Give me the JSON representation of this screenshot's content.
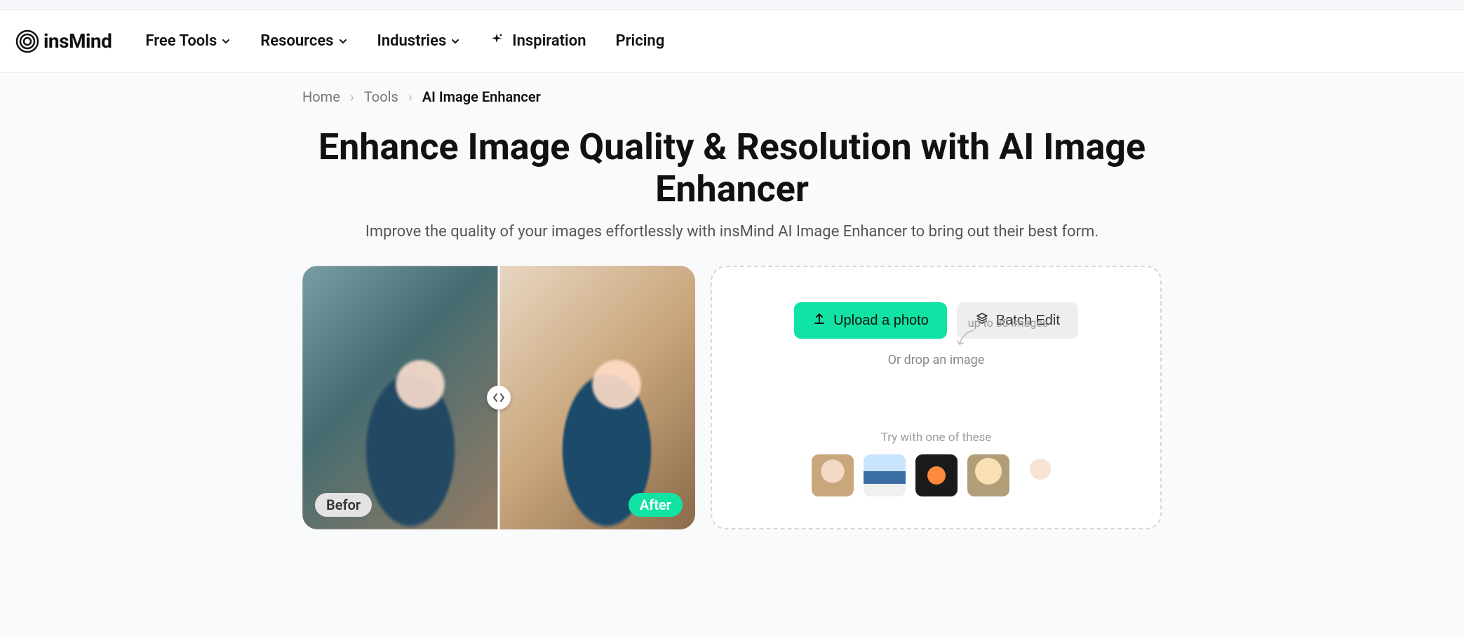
{
  "brand": "insMind",
  "nav": {
    "free_tools": "Free Tools",
    "resources": "Resources",
    "industries": "Industries",
    "inspiration": "Inspiration",
    "pricing": "Pricing"
  },
  "breadcrumb": {
    "home": "Home",
    "tools": "Tools",
    "current": "AI Image Enhancer"
  },
  "hero": {
    "title": "Enhance Image Quality & Resolution with AI Image Enhancer",
    "subtitle": "Improve the quality of your images effortlessly with insMind AI Image Enhancer to bring out their best form."
  },
  "compare": {
    "before_label": "Befor",
    "after_label": "After"
  },
  "upload": {
    "note": "up to 30 images",
    "primary_btn": "Upload a photo",
    "secondary_btn": "Batch Edit",
    "drop_text": "Or drop an image",
    "samples_label": "Try with one of these"
  }
}
